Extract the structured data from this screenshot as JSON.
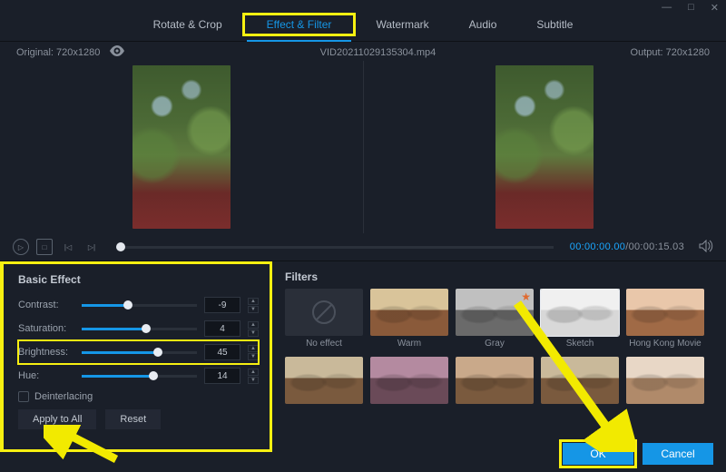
{
  "window": {
    "minimize": "—",
    "maximize": "□",
    "close": "✕"
  },
  "tabs": {
    "rotate": "Rotate & Crop",
    "effect": "Effect & Filter",
    "watermark": "Watermark",
    "audio": "Audio",
    "subtitle": "Subtitle",
    "active": "effect"
  },
  "meta": {
    "original_label": "Original:",
    "original_res": "720x1280",
    "filename": "VID20211029135304.mp4",
    "output_label": "Output:",
    "output_res": "720x1280"
  },
  "transport": {
    "current": "00:00:00.00",
    "total": "00:00:15.03"
  },
  "basic": {
    "title": "Basic Effect",
    "contrast": {
      "label": "Contrast:",
      "value": -9,
      "pct": 40
    },
    "saturation": {
      "label": "Saturation:",
      "value": 4,
      "pct": 56
    },
    "brightness": {
      "label": "Brightness:",
      "value": 45,
      "pct": 66
    },
    "hue": {
      "label": "Hue:",
      "value": 14,
      "pct": 62
    },
    "deinterlacing": "Deinterlacing",
    "apply_all": "Apply to All",
    "reset": "Reset"
  },
  "filters": {
    "title": "Filters",
    "items": [
      {
        "name": "No effect",
        "kind": "none"
      },
      {
        "name": "Warm",
        "kind": "scene",
        "sky": "#d9c49a",
        "ground": "#8a5a3a"
      },
      {
        "name": "Gray",
        "kind": "scene",
        "sky": "#c0c0c0",
        "ground": "#6a6a6a",
        "star": true
      },
      {
        "name": "Sketch",
        "kind": "scene",
        "sky": "#f0f0f0",
        "ground": "#d8d8d8",
        "selected": true
      },
      {
        "name": "Hong Kong Movie",
        "kind": "scene",
        "sky": "#e9c7aa",
        "ground": "#a06a46"
      },
      {
        "name": "",
        "kind": "scene",
        "sky": "#c9b99a",
        "ground": "#7a5a3e"
      },
      {
        "name": "",
        "kind": "scene",
        "sky": "#b48aa0",
        "ground": "#6a4a58"
      },
      {
        "name": "",
        "kind": "scene",
        "sky": "#c9a98a",
        "ground": "#7a5a3e"
      },
      {
        "name": "",
        "kind": "scene",
        "sky": "#c9b99a",
        "ground": "#7a5a3e"
      },
      {
        "name": "",
        "kind": "scene",
        "sky": "#e8d7c6",
        "ground": "#b08a6a"
      }
    ]
  },
  "footer": {
    "ok": "OK",
    "cancel": "Cancel"
  }
}
